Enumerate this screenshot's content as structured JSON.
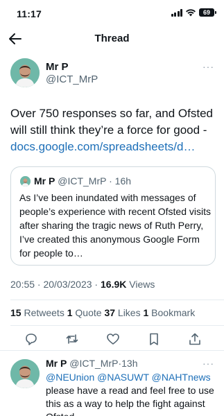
{
  "status_bar": {
    "time": "11:17",
    "battery": "69"
  },
  "nav": {
    "title": "Thread"
  },
  "tweet": {
    "name": "Mr P",
    "handle": "@ICT_MrP",
    "more": "···",
    "text": "Over 750 responses so far, and Ofsted will still think they’re a force for good - ",
    "link": "docs.google.com/spreadsheets/d…",
    "quote": {
      "name": "Mr P",
      "handle": "@ICT_MrP",
      "separator": "·",
      "time": "16h",
      "text": "As I’ve been inundated with messages of people’s experience with recent Ofsted visits after sharing the tragic news of Ruth Perry, I’ve created this anonymous Google Form for people to…"
    },
    "timestamp": "20:55 · 20/03/2023 · ",
    "views_count": "16.9K",
    "views_label": " Views",
    "stats": {
      "retweets_count": "15",
      "retweets_label": " Retweets ",
      "quotes_count": "1",
      "quotes_label": " Quote ",
      "likes_count": "37",
      "likes_label": " Likes ",
      "bookmarks_count": "1",
      "bookmarks_label": " Bookmark"
    },
    "actions": [
      "reply-icon",
      "retweet-icon",
      "like-icon",
      "bookmark-icon",
      "share-icon"
    ]
  },
  "reply": {
    "name": "Mr P",
    "handle": "@ICT_MrP",
    "separator": "·",
    "time": "13h",
    "more": "···",
    "mentions": [
      "@NEUnion",
      "@NASUWT",
      "@NAHTnews"
    ],
    "text": "please have a read and feel free to use this as a way to help the fight against Ofsted"
  },
  "colors": {
    "accent": "#1d6fb8",
    "muted": "#536471",
    "avatar_bg": "#6fb8a8"
  }
}
